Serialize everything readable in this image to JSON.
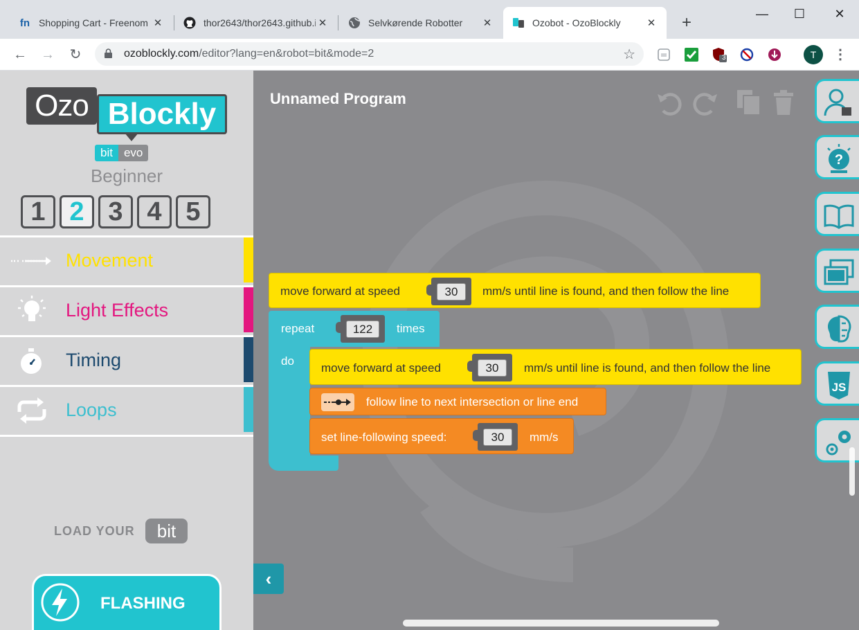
{
  "browser": {
    "tabs": [
      {
        "title": "Shopping Cart - Freenom",
        "icon": "freenom-icon"
      },
      {
        "title": "thor2643/thor2643.github.io",
        "icon": "github-icon"
      },
      {
        "title": "Selvkørende Robotter",
        "icon": "globe-icon"
      },
      {
        "title": "Ozobot - OzoBlockly",
        "icon": "ozobot-icon"
      }
    ],
    "close_glyph": "✕",
    "new_tab": "+",
    "window_controls": {
      "minimize": "—",
      "maximize": "☐",
      "close": "✕"
    },
    "url_host": "ozoblockly.com",
    "url_path": "/editor?lang=en&robot=bit&mode=2",
    "profile_initial": "T",
    "extension_badge": "3",
    "nav_glyphs": {
      "back": "←",
      "forward": "→",
      "reload": "↻",
      "star": "☆",
      "menu": "⋮"
    }
  },
  "sidebar": {
    "logo": {
      "ozo": "Ozo",
      "blockly": "Blockly"
    },
    "variants": [
      "bit",
      "evo"
    ],
    "level_name": "Beginner",
    "levels": [
      "1",
      "2",
      "3",
      "4",
      "5"
    ],
    "active_level": "2",
    "categories": [
      {
        "label": "Movement",
        "color": "#ffe100",
        "icon": "arrow-right-icon"
      },
      {
        "label": "Light Effects",
        "color": "#e3167f",
        "icon": "light-bulb-icon"
      },
      {
        "label": "Timing",
        "color": "#1d4a6e",
        "icon": "stopwatch-icon"
      },
      {
        "label": "Loops",
        "color": "#3dbfcf",
        "icon": "loop-arrows-icon"
      }
    ],
    "load_label": "LOAD YOUR",
    "load_badge": "bit",
    "flash_label": "FLASHING",
    "collapse_glyph": "‹"
  },
  "workspace": {
    "title": "Unnamed Program",
    "blocks": {
      "move1": {
        "prefix": "move forward at speed",
        "value": "30",
        "suffix": "mm/s until line is found, and then follow the line"
      },
      "repeat": {
        "prefix": "repeat",
        "value": "122",
        "suffix": "times",
        "do": "do"
      },
      "move2": {
        "prefix": "move forward at speed",
        "value": "30",
        "suffix": "mm/s until line is found, and then follow the line"
      },
      "follow": {
        "label": "follow line to next intersection or line end"
      },
      "speed": {
        "prefix": "set line-following speed:",
        "value": "30",
        "suffix": "mm/s"
      }
    },
    "colors": {
      "background": "#8a8a8d",
      "movement": "#ffe100",
      "loops": "#3dbfcf",
      "line_nav": "#f48a23",
      "accent": "#21c4cf"
    },
    "rail_icons": [
      "account-icon",
      "help-icon",
      "book-icon",
      "windows-icon",
      "brain-icon",
      "javascript-icon",
      "settings-icon"
    ]
  }
}
